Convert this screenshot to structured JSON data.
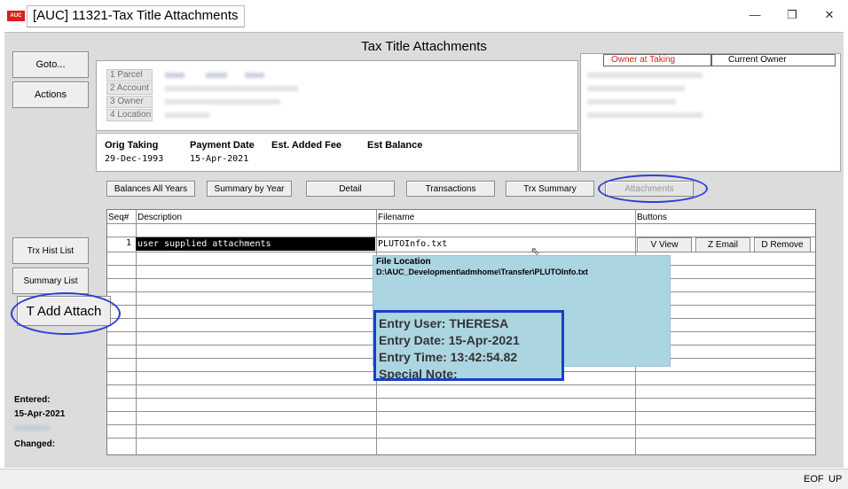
{
  "window": {
    "logo": "AUC",
    "title": "[AUC] 11321-Tax Title Attachments",
    "minimize": "—",
    "restore": "❐",
    "close": "✕"
  },
  "page_title": "Tax Title Attachments",
  "left_buttons": {
    "goto": "Goto...",
    "actions": "Actions"
  },
  "id_labels": [
    "1 Parcel",
    "2 Account",
    "3 Owner",
    "4 Location"
  ],
  "owner_tabs": {
    "owner_at_taking": "Owner at Taking",
    "current_owner": "Current Owner"
  },
  "summary": {
    "headers": [
      "Orig Taking",
      "Payment Date",
      "Est. Added Fee",
      "Est Balance"
    ],
    "values": [
      "29-Dec-1993",
      "15-Apr-2021",
      "",
      ""
    ]
  },
  "tabs": [
    "Balances All Years",
    "Summary by Year",
    "Detail",
    "Transactions",
    "Trx Summary",
    "Attachments"
  ],
  "grid": {
    "columns": [
      "Seq#",
      "Description",
      "Filename",
      "Buttons"
    ],
    "row": {
      "seq": "1",
      "description": "user supplied attachments",
      "filename": "PLUTOInfo.txt",
      "buttons": [
        "V View",
        "Z Email",
        "D Remove"
      ]
    }
  },
  "tooltip": {
    "title": "File Location",
    "path": "D:\\AUC_Development\\admhome\\Transfer\\PLUTOInfo.txt",
    "entry_user": "Entry User: THERESA",
    "entry_date": "Entry Date: 15-Apr-2021",
    "entry_time": "Entry Time: 13:42:54.82",
    "special_note": "Special Note:"
  },
  "side_buttons": {
    "trx_hist": "Trx Hist List",
    "summary_list": "Summary List",
    "add_attach": "T Add Attach"
  },
  "audit": {
    "entered_label": "Entered:",
    "entered_date": "15-Apr-2021",
    "changed_label": "Changed:"
  },
  "status": {
    "eof": "EOF",
    "up": "UP"
  },
  "colors": {
    "highlight_oval": "#2e3fd5",
    "tooltip_bg": "#acd5e2",
    "owner_tab_text": "#d8201f"
  }
}
